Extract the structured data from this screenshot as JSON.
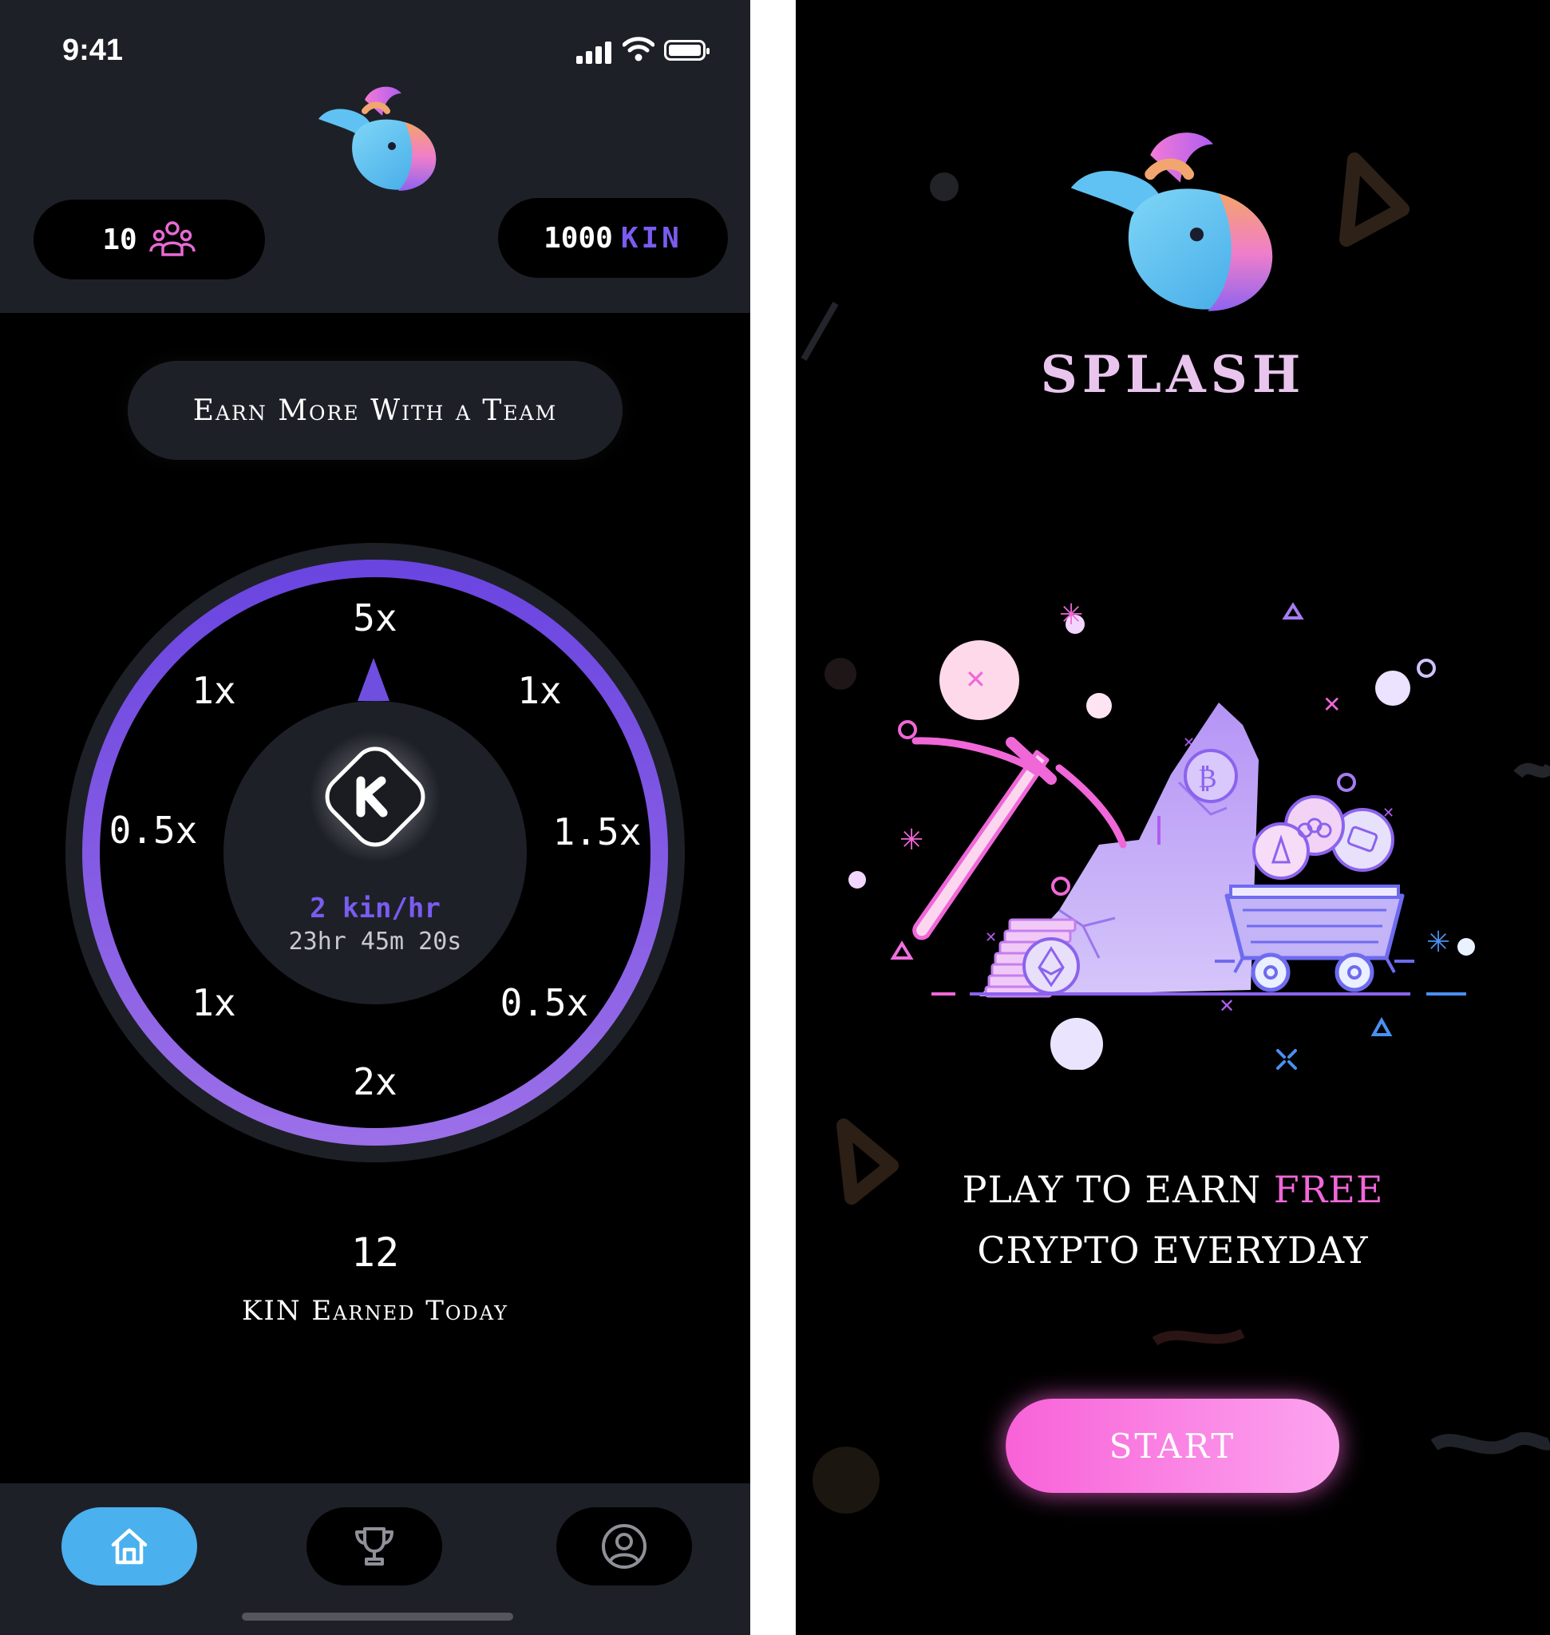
{
  "left_screen": {
    "status_bar": {
      "time": "9:41"
    },
    "header": {
      "team_count": "10",
      "kin_balance": "1000",
      "kin_unit": "KIN"
    },
    "team_button_label": "Earn More With a Team",
    "wheel": {
      "segments": [
        "5x",
        "1x",
        "1.5x",
        "0.5x",
        "2x",
        "1x",
        "0.5x",
        "1x"
      ],
      "rate": "2 kin/hr",
      "countdown": "23hr 45m 20s"
    },
    "earned": {
      "value": "12",
      "label": "KIN Earned Today"
    },
    "nav": {
      "items": [
        {
          "icon": "home-icon",
          "active": true
        },
        {
          "icon": "trophy-icon",
          "active": false
        },
        {
          "icon": "profile-icon",
          "active": false
        }
      ]
    }
  },
  "right_screen": {
    "app_name": "SPLASH",
    "tagline_part1": "PLAY TO EARN ",
    "tagline_highlight": "FREE",
    "tagline_part2": "CRYPTO EVERYDAY",
    "start_label": "START"
  },
  "colors": {
    "accent_purple": "#7a5cf0",
    "nav_active": "#4ab0ee",
    "pink": "#f067d8",
    "panel": "#1e2028"
  }
}
